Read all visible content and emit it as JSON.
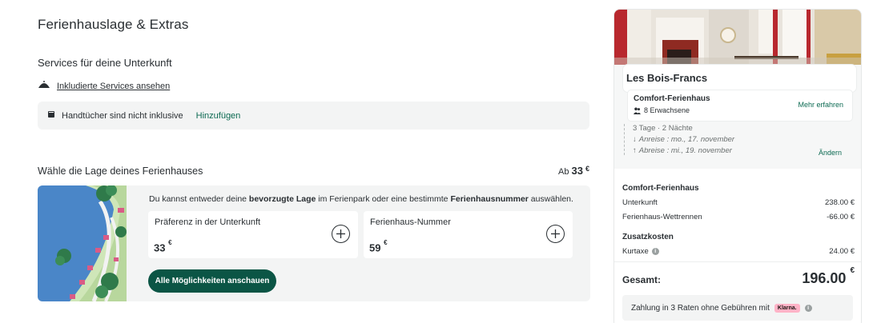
{
  "main": {
    "title": "Ferienhauslage & Extras",
    "services": {
      "heading": "Services für deine Unterkunft",
      "link_label": "Inkludierte Services ansehen",
      "towel_text": "Handtücher sind nicht inklusive",
      "towel_add": "Hinzufügen"
    },
    "location": {
      "heading": "Wähle die Lage deines Ferienhauses",
      "from_label": "Ab",
      "from_price": "33",
      "currency": "€",
      "desc_1": "Du kannst entweder deine ",
      "desc_bold_1": "bevorzugte Lage",
      "desc_2": " im Ferienpark oder eine bestimmte ",
      "desc_bold_2": "Ferienhausnummer",
      "desc_3": " auswählen.",
      "options": [
        {
          "label": "Präferenz in der Unterkunft",
          "price": "33",
          "currency": "€"
        },
        {
          "label": "Ferienhaus-Nummer",
          "price": "59",
          "currency": "€"
        }
      ],
      "cta": "Alle Möglichkeiten anschauen"
    }
  },
  "summary": {
    "park_name": "Les Bois-Francs",
    "house_type": "Comfort-Ferienhaus",
    "guests": "8 Erwachsene",
    "more_link": "Mehr erfahren",
    "duration": "3 Tage · 2 Nächte",
    "arrival": "Anreise : mo., 17. november",
    "departure": "Abreise : mi., 19. november",
    "change_link": "Ändern",
    "price_section_heading": "Comfort-Ferienhaus",
    "rows": [
      {
        "label": "Unterkunft",
        "value": "238.00 €"
      },
      {
        "label": "Ferienhaus-Wettrennen",
        "value": "-66.00 €"
      }
    ],
    "extras_heading": "Zusatzkosten",
    "extras": [
      {
        "label": "Kurtaxe",
        "value": "24.00 €"
      }
    ],
    "total_label": "Gesamt:",
    "total_value": "196.00",
    "total_currency": "€",
    "klarna_text": "Zahlung in 3 Raten ohne Gebühren mit",
    "klarna_badge": "Klarna."
  },
  "colors": {
    "accent_green": "#0c6a52",
    "cta_bg": "#0b5545",
    "panel_bg": "#f3f4f4",
    "klarna_pink": "#ffb3c7"
  }
}
